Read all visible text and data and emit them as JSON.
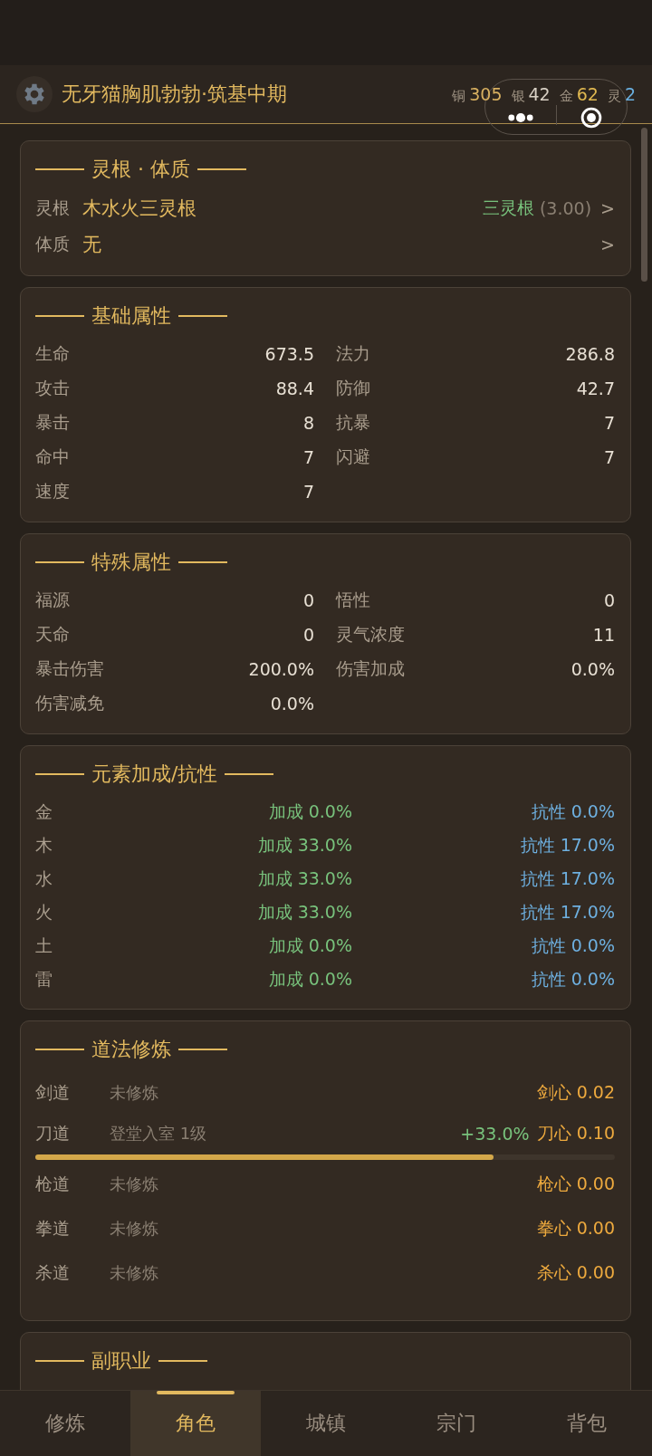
{
  "header": {
    "title": "无牙猫胸肌勃勃·筑基中期",
    "currencies": [
      {
        "unit": "铜",
        "amount": "305",
        "color": "#d8b060"
      },
      {
        "unit": "银",
        "amount": "42",
        "color": "#d8d0c4"
      },
      {
        "unit": "金",
        "amount": "62",
        "color": "#e0b850"
      },
      {
        "unit": "灵",
        "amount": "2",
        "color": "#6ab0e0"
      }
    ]
  },
  "root_card": {
    "title": "灵根 · 体质",
    "rows": [
      {
        "label": "灵根",
        "value": "木水火三灵根",
        "tag": "三灵根",
        "score": "(3.00)",
        "arrow": ">"
      },
      {
        "label": "体质",
        "value": "无",
        "arrow": ">"
      }
    ]
  },
  "base_card": {
    "title": "基础属性",
    "stats": [
      {
        "label": "生命",
        "value": "673.5"
      },
      {
        "label": "法力",
        "value": "286.8"
      },
      {
        "label": "攻击",
        "value": "88.4"
      },
      {
        "label": "防御",
        "value": "42.7"
      },
      {
        "label": "暴击",
        "value": "8"
      },
      {
        "label": "抗暴",
        "value": "7"
      },
      {
        "label": "命中",
        "value": "7"
      },
      {
        "label": "闪避",
        "value": "7"
      },
      {
        "label": "速度",
        "value": "7"
      }
    ]
  },
  "special_card": {
    "title": "特殊属性",
    "stats": [
      {
        "label": "福源",
        "value": "0"
      },
      {
        "label": "悟性",
        "value": "0"
      },
      {
        "label": "天命",
        "value": "0"
      },
      {
        "label": "灵气浓度",
        "value": "11"
      },
      {
        "label": "暴击伤害",
        "value": "200.0%"
      },
      {
        "label": "伤害加成",
        "value": "0.0%"
      },
      {
        "label": "伤害减免",
        "value": "0.0%"
      }
    ]
  },
  "element_card": {
    "title": "元素加成/抗性",
    "rows": [
      {
        "element": "金",
        "bonus": "加成 0.0%",
        "resist": "抗性 0.0%"
      },
      {
        "element": "木",
        "bonus": "加成 33.0%",
        "resist": "抗性 17.0%"
      },
      {
        "element": "水",
        "bonus": "加成 33.0%",
        "resist": "抗性 17.0%"
      },
      {
        "element": "火",
        "bonus": "加成 33.0%",
        "resist": "抗性 17.0%"
      },
      {
        "element": "土",
        "bonus": "加成 0.0%",
        "resist": "抗性 0.0%"
      },
      {
        "element": "雷",
        "bonus": "加成 0.0%",
        "resist": "抗性 0.0%"
      }
    ]
  },
  "dao_card": {
    "title": "道法修炼",
    "rows": [
      {
        "name": "剑道",
        "status": "未修炼",
        "value": "剑心 0.02"
      },
      {
        "name": "刀道",
        "status": "登堂入室 1级",
        "bonus": "+33.0%",
        "value": "刀心 0.10",
        "level": 0.79
      },
      {
        "name": "枪道",
        "status": "未修炼",
        "value": "枪心 0.00"
      },
      {
        "name": "拳道",
        "status": "未修炼",
        "value": "拳心 0.00"
      },
      {
        "name": "杀道",
        "status": "未修炼",
        "value": "杀心 0.00"
      }
    ]
  },
  "job_card": {
    "title": "副职业"
  },
  "tabs": [
    {
      "label": "修炼",
      "selected": false
    },
    {
      "label": "角色",
      "selected": true
    },
    {
      "label": "城镇",
      "selected": false
    },
    {
      "label": "宗门",
      "selected": false
    },
    {
      "label": "背包",
      "selected": false
    }
  ]
}
